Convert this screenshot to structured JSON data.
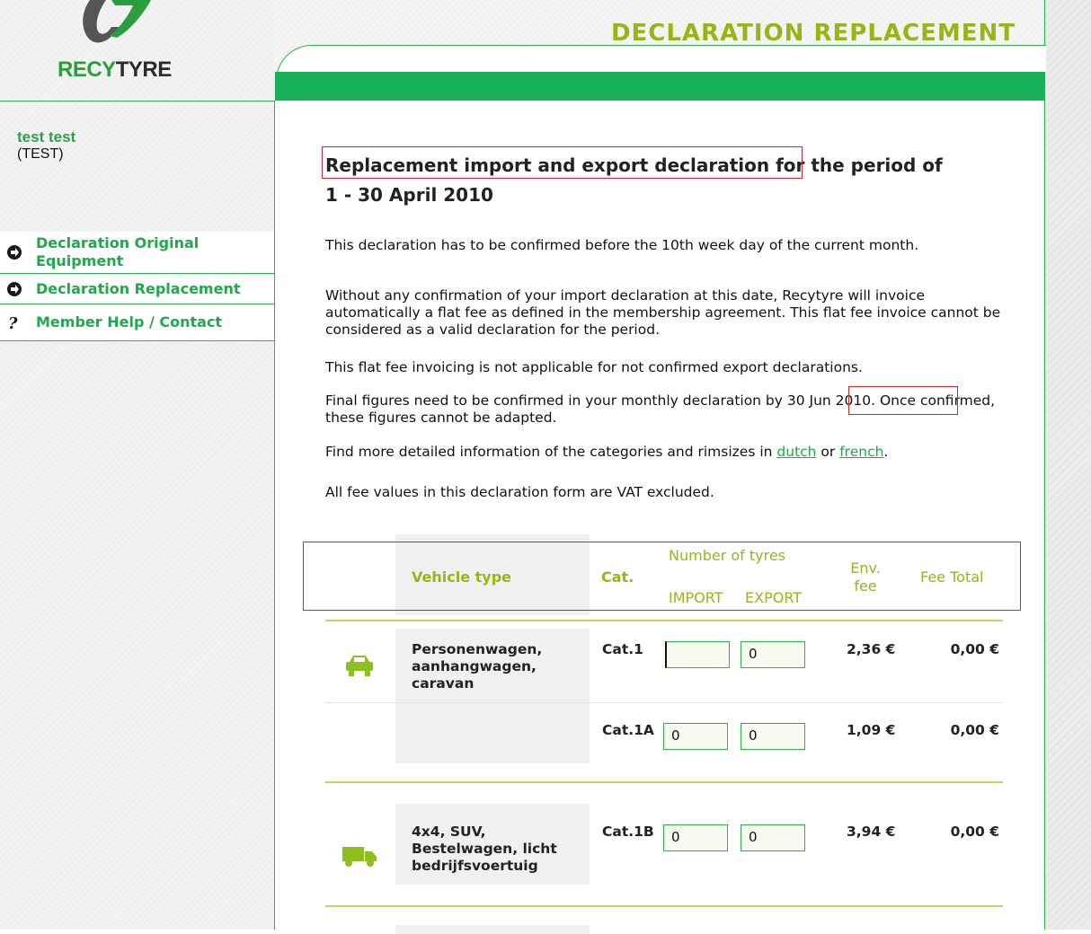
{
  "header": {
    "logo_text_a": "RECY",
    "logo_text_b": "TYRE",
    "page_title": "DECLARATION REPLACEMENT"
  },
  "user": {
    "name": "test test",
    "code": "(TEST)"
  },
  "nav": [
    {
      "label": "Declaration Original Equipment",
      "icon": "arrow-circle-icon"
    },
    {
      "label": "Declaration Replacement",
      "icon": "arrow-circle-icon"
    },
    {
      "label": "Member Help / Contact",
      "icon": "question-icon"
    }
  ],
  "content": {
    "heading_a": "Replacement import and export declaration",
    "heading_b": " for the period of",
    "heading_period": "1 - 30 April 2010",
    "p1": "This declaration has to be confirmed before the 10th week day of the current month.",
    "p2": "Without any confirmation of your import declaration at this date, Recytyre will invoice automatically a flat fee as defined in the membership agreement. This flat fee invoice cannot be considered as a valid declaration for the period.",
    "p3": "This flat fee invoicing is not applicable for not confirmed export declarations.",
    "p4_a": "Final figures need to be confirmed in your monthly declaration by ",
    "p4_date": "30 Jun 2010.",
    "p4_b": " Once confirmed, these figures cannot be adapted.",
    "p5_a": "Find more detailed information of the categories and rimsizes in ",
    "p5_link1": "dutch",
    "p5_mid": " or ",
    "p5_link2": "french",
    "p5_end": ".",
    "p6": "All fee values in this declaration form are VAT excluded."
  },
  "table": {
    "headers": {
      "vehicle_type": "Vehicle type",
      "cat": "Cat.",
      "num_tyres": "Number of tyres",
      "import": "IMPORT",
      "export": "EXPORT",
      "env_fee": "Env. fee",
      "fee_total": "Fee Total"
    },
    "rows": [
      {
        "vehicle": "Personenwagen, aanhangwagen, caravan",
        "icon": "car-icon",
        "cat": "Cat.1",
        "import": "",
        "export": "0",
        "fee": "2,36 €",
        "total": "0,00 €"
      },
      {
        "vehicle": "",
        "icon": "",
        "cat": "Cat.1A",
        "import": "0",
        "export": "0",
        "fee": "1,09 €",
        "total": "0,00 €"
      },
      {
        "vehicle": "4x4, SUV, Bestelwagen, licht bedrijfsvoertuig",
        "icon": "truck-icon",
        "cat": "Cat.1B",
        "import": "0",
        "export": "0",
        "fee": "3,94 €",
        "total": "0,00 €"
      }
    ]
  },
  "colors": {
    "brand_green": "#17b157",
    "accent_olive": "#9cb317",
    "highlight_red": "#e1202b"
  }
}
